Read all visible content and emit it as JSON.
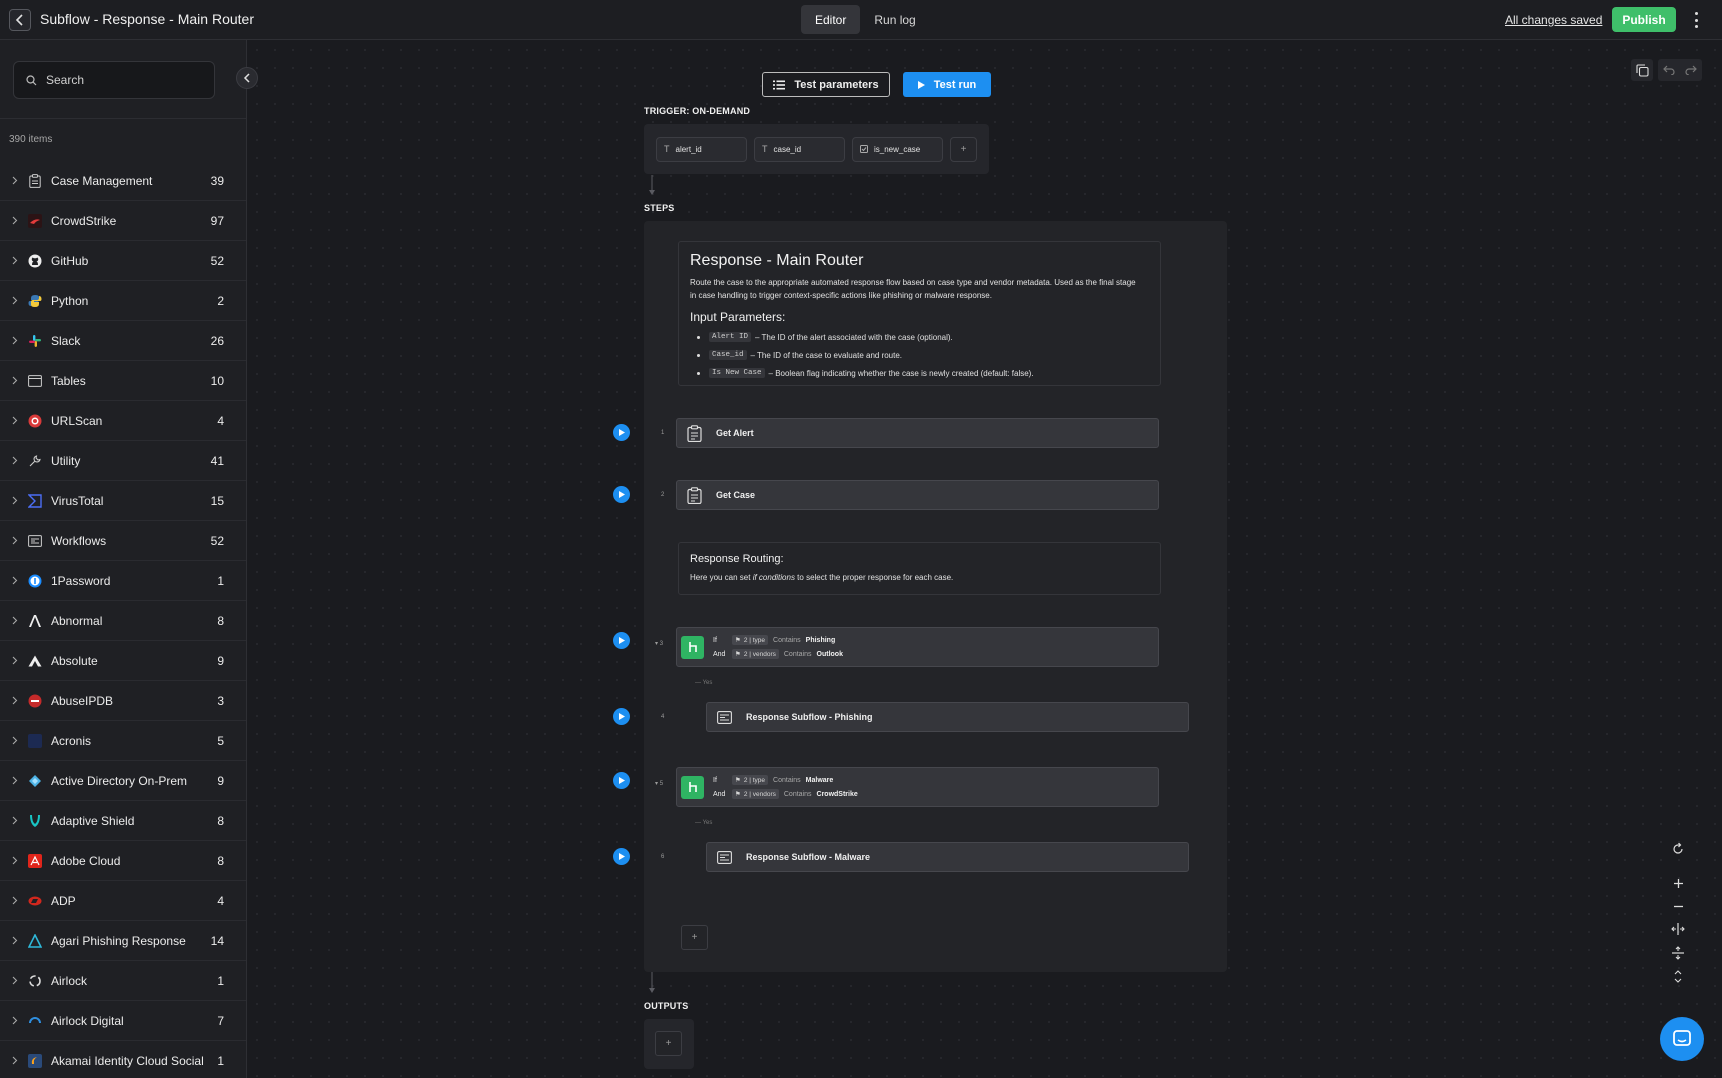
{
  "header": {
    "title": "Subflow - Response - Main Router",
    "tabs": [
      {
        "label": "Editor",
        "active": true
      },
      {
        "label": "Run log",
        "active": false
      }
    ],
    "saved_status": "All changes saved",
    "publish_label": "Publish"
  },
  "sidebar": {
    "search_placeholder": "Search",
    "item_count": "390 items",
    "categories": [
      {
        "name": "Case Management",
        "count": "39",
        "icon": "clipboard-icon"
      },
      {
        "name": "CrowdStrike",
        "count": "97",
        "icon": "crowdstrike-icon"
      },
      {
        "name": "GitHub",
        "count": "52",
        "icon": "github-icon"
      },
      {
        "name": "Python",
        "count": "2",
        "icon": "python-icon"
      },
      {
        "name": "Slack",
        "count": "26",
        "icon": "slack-icon"
      },
      {
        "name": "Tables",
        "count": "10",
        "icon": "table-icon"
      },
      {
        "name": "URLScan",
        "count": "4",
        "icon": "urlscan-icon"
      },
      {
        "name": "Utility",
        "count": "41",
        "icon": "wrench-icon"
      },
      {
        "name": "VirusTotal",
        "count": "15",
        "icon": "virustotal-icon"
      },
      {
        "name": "Workflows",
        "count": "52",
        "icon": "workflow-icon"
      },
      {
        "name": "1Password",
        "count": "1",
        "icon": "onepassword-icon"
      },
      {
        "name": "Abnormal",
        "count": "8",
        "icon": "abnormal-icon"
      },
      {
        "name": "Absolute",
        "count": "9",
        "icon": "absolute-icon"
      },
      {
        "name": "AbuseIPDB",
        "count": "3",
        "icon": "abuseipdb-icon"
      },
      {
        "name": "Acronis",
        "count": "5",
        "icon": "acronis-icon"
      },
      {
        "name": "Active Directory On-Prem",
        "count": "9",
        "icon": "active-directory-icon"
      },
      {
        "name": "Adaptive Shield",
        "count": "8",
        "icon": "adaptive-shield-icon"
      },
      {
        "name": "Adobe Cloud",
        "count": "8",
        "icon": "adobe-icon"
      },
      {
        "name": "ADP",
        "count": "4",
        "icon": "adp-icon"
      },
      {
        "name": "Agari Phishing Response",
        "count": "14",
        "icon": "agari-icon"
      },
      {
        "name": "Airlock",
        "count": "1",
        "icon": "airlock-icon"
      },
      {
        "name": "Airlock Digital",
        "count": "7",
        "icon": "airlock-digital-icon"
      },
      {
        "name": "Akamai Identity Cloud Social",
        "count": "1",
        "icon": "akamai-icon"
      }
    ]
  },
  "canvas": {
    "test_params_label": "Test parameters",
    "test_run_label": "Test run",
    "trigger_label": "TRIGGER: ON-DEMAND",
    "trigger_params": [
      "alert_id",
      "case_id",
      "is_new_case"
    ],
    "add_symbol": "+",
    "steps_label": "STEPS",
    "outputs_label": "OUTPUTS",
    "note1": {
      "title": "Response - Main Router",
      "desc_line1": "Route the case to the appropriate automated response flow based on case type and vendor metadata. Used as the final stage",
      "desc_line2": "in case handling to trigger context-specific actions like phishing or malware response.",
      "subtitle": "Input Parameters:",
      "params": [
        {
          "code": "Alert ID",
          "text": "– The ID of the alert associated with the case (optional)."
        },
        {
          "code": "Case_id",
          "text": "– The ID of the case to evaluate and route."
        },
        {
          "code": "Is New Case",
          "text": "– Boolean flag indicating whether the case is newly created (default: false)."
        }
      ]
    },
    "note2": {
      "title": "Response Routing:",
      "desc_prefix": "Here you can set ",
      "desc_em": "if conditions",
      "desc_suffix": " to select the proper response for each case."
    },
    "steps": [
      {
        "num": "1",
        "label": "Get Alert"
      },
      {
        "num": "2",
        "label": "Get Case"
      },
      {
        "num": "3",
        "type": "if",
        "cond1": {
          "kw": "If",
          "var": "2 | type",
          "op": "Contains",
          "val": "Phishing"
        },
        "cond2": {
          "kw": "And",
          "var": "2 | vendors",
          "op": "Contains",
          "val": "Outlook"
        }
      },
      {
        "num": "4",
        "label": "Response Subflow - Phishing"
      },
      {
        "num": "5",
        "type": "if",
        "cond1": {
          "kw": "If",
          "var": "2 | type",
          "op": "Contains",
          "val": "Malware"
        },
        "cond2": {
          "kw": "And",
          "var": "2 | vendors",
          "op": "Contains",
          "val": "CrowdStrike"
        }
      },
      {
        "num": "6",
        "label": "Response Subflow - Malware"
      }
    ],
    "yes_label": "Yes"
  },
  "colors": {
    "accent_blue": "#1d8ff1",
    "publish_green": "#3fbf6a",
    "if_green": "#2fb463"
  }
}
